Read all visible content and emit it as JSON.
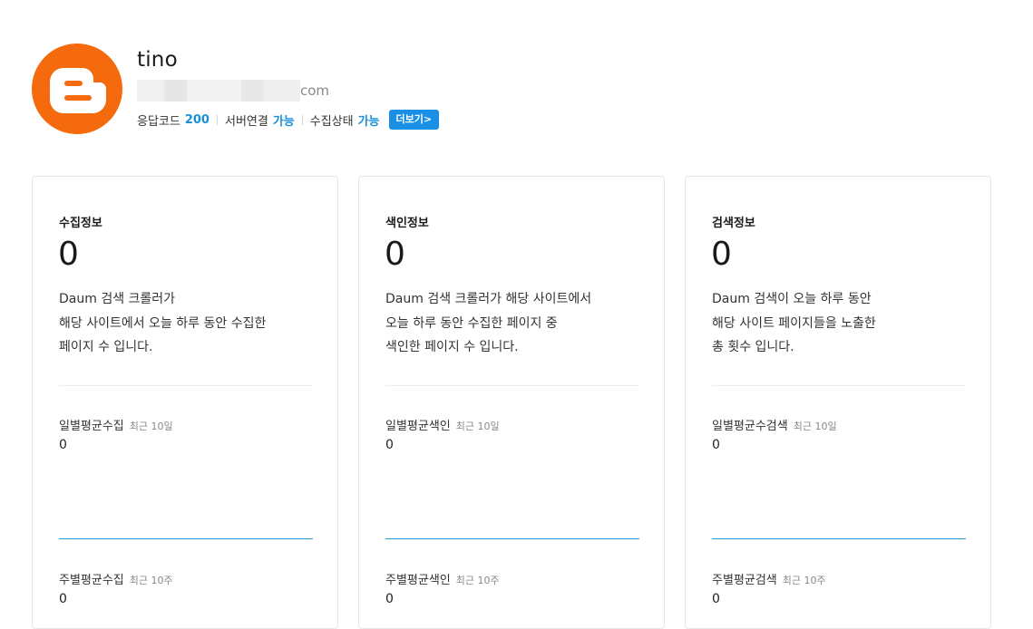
{
  "profile": {
    "name": "tino",
    "url_suffix": "com",
    "avatar_icon": "blogger-icon",
    "avatar_color": "#f46a0c",
    "status": {
      "response_label": "응답코드",
      "response_value": "200",
      "server_label": "서버연결",
      "server_value": "가능",
      "crawl_label": "수집상태",
      "crawl_value": "가능",
      "more_button": "더보기>"
    }
  },
  "cards": [
    {
      "title": "수집정보",
      "count": "0",
      "desc": [
        "Daum 검색 크롤러가",
        "해당 사이트에서 오늘 하루 동안 수집한",
        "페이지 수 입니다."
      ],
      "daily_label": "일별평균수집",
      "daily_sub": "최근 10일",
      "daily_value": "0",
      "weekly_label": "주별평균수집",
      "weekly_sub": "최근 10주",
      "weekly_value": "0"
    },
    {
      "title": "색인정보",
      "count": "0",
      "desc": [
        "Daum 검색 크롤러가 해당 사이트에서",
        "오늘 하루 동안 수집한 페이지 중",
        "색인한 페이지 수 입니다."
      ],
      "daily_label": "일별평균색인",
      "daily_sub": "최근 10일",
      "daily_value": "0",
      "weekly_label": "주별평균색인",
      "weekly_sub": "최근 10주",
      "weekly_value": "0"
    },
    {
      "title": "검색정보",
      "count": "0",
      "desc": [
        "Daum 검색이 오늘 하루 동안",
        "해당 사이트 페이지들을 노출한",
        "총 횟수 입니다."
      ],
      "daily_label": "일별평균수검색",
      "daily_sub": "최근 10일",
      "daily_value": "0",
      "weekly_label": "주별평균검색",
      "weekly_sub": "최근 10주",
      "weekly_value": "0"
    }
  ],
  "colors": {
    "accent": "#1a8fd8",
    "button": "#1a8fe6",
    "chart_line": "#2a9bd8"
  }
}
